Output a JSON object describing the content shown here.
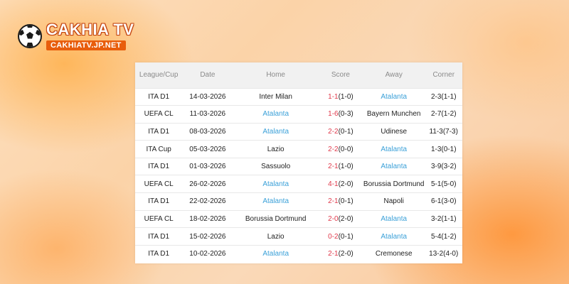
{
  "brand": {
    "name": "CAKHIA TV",
    "domain": "CAKHIATV.JP.NET"
  },
  "colors": {
    "accent": "#e85d0c",
    "link": "#3aa0d8",
    "score_red": "#e0394b"
  },
  "table": {
    "headers": [
      "League/Cup",
      "Date",
      "Home",
      "Score",
      "Away",
      "Corner"
    ],
    "rows": [
      {
        "league": "ITA D1",
        "date": "14-03-2026",
        "home": "Inter Milan",
        "home_link": false,
        "s1": "1",
        "s2": "1",
        "ht": "(1-0)",
        "away": "Atalanta",
        "away_link": true,
        "corner": "2-3(1-1)"
      },
      {
        "league": "UEFA CL",
        "date": "11-03-2026",
        "home": "Atalanta",
        "home_link": true,
        "s1": "1",
        "s2": "6",
        "ht": "(0-3)",
        "away": "Bayern Munchen",
        "away_link": false,
        "corner": "2-7(1-2)"
      },
      {
        "league": "ITA D1",
        "date": "08-03-2026",
        "home": "Atalanta",
        "home_link": true,
        "s1": "2",
        "s2": "2",
        "ht": "(0-1)",
        "away": "Udinese",
        "away_link": false,
        "corner": "11-3(7-3)"
      },
      {
        "league": "ITA Cup",
        "date": "05-03-2026",
        "home": "Lazio",
        "home_link": false,
        "s1": "2",
        "s2": "2",
        "ht": "(0-0)",
        "away": "Atalanta",
        "away_link": true,
        "corner": "1-3(0-1)"
      },
      {
        "league": "ITA D1",
        "date": "01-03-2026",
        "home": "Sassuolo",
        "home_link": false,
        "s1": "2",
        "s2": "1",
        "ht": "(1-0)",
        "away": "Atalanta",
        "away_link": true,
        "corner": "3-9(3-2)"
      },
      {
        "league": "UEFA CL",
        "date": "26-02-2026",
        "home": "Atalanta",
        "home_link": true,
        "s1": "4",
        "s2": "1",
        "ht": "(2-0)",
        "away": "Borussia Dortmund",
        "away_link": false,
        "corner": "5-1(5-0)"
      },
      {
        "league": "ITA D1",
        "date": "22-02-2026",
        "home": "Atalanta",
        "home_link": true,
        "s1": "2",
        "s2": "1",
        "ht": "(0-1)",
        "away": "Napoli",
        "away_link": false,
        "corner": "6-1(3-0)"
      },
      {
        "league": "UEFA CL",
        "date": "18-02-2026",
        "home": "Borussia Dortmund",
        "home_link": false,
        "s1": "2",
        "s2": "0",
        "ht": "(2-0)",
        "away": "Atalanta",
        "away_link": true,
        "corner": "3-2(1-1)"
      },
      {
        "league": "ITA D1",
        "date": "15-02-2026",
        "home": "Lazio",
        "home_link": false,
        "s1": "0",
        "s2": "2",
        "ht": "(0-1)",
        "away": "Atalanta",
        "away_link": true,
        "corner": "5-4(1-2)"
      },
      {
        "league": "ITA D1",
        "date": "10-02-2026",
        "home": "Atalanta",
        "home_link": true,
        "s1": "2",
        "s2": "1",
        "ht": "(2-0)",
        "away": "Cremonese",
        "away_link": false,
        "corner": "13-2(4-0)"
      }
    ]
  }
}
